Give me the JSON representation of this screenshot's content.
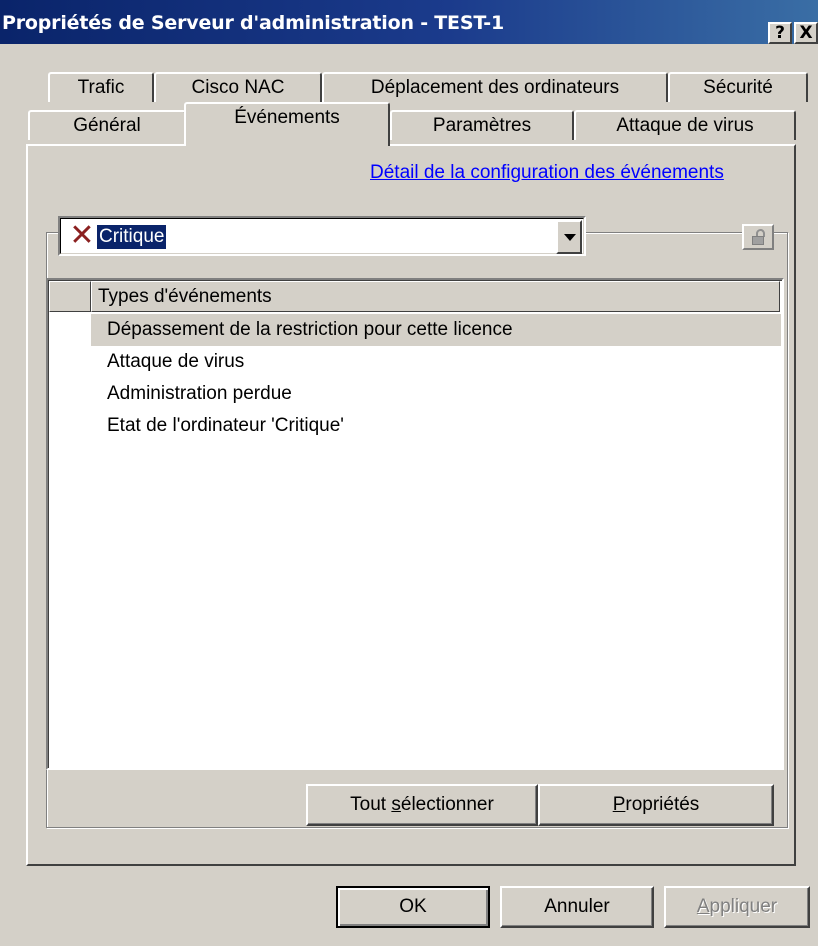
{
  "window": {
    "title": "Propriétés de Serveur d'administration - TEST-1",
    "help_button": "?",
    "close_button": "X"
  },
  "tabs_back_row": [
    {
      "label": "Trafic"
    },
    {
      "label": "Cisco NAC"
    },
    {
      "label": "Déplacement des ordinateurs"
    },
    {
      "label": "Sécurité"
    }
  ],
  "tabs_front_row": [
    {
      "label": "Général"
    },
    {
      "label": "Événements",
      "active": true
    },
    {
      "label": "Paramètres"
    },
    {
      "label": "Attaque de virus"
    }
  ],
  "events": {
    "config_link": "Détail de la configuration des événements",
    "severity_select": {
      "value": "Critique",
      "icon": "red-x-critical-icon"
    },
    "lock_icon": "padlock-icon",
    "list": {
      "column_header": "Types d'événements",
      "rows": [
        "Dépassement de la restriction pour cette licence",
        "Attaque de virus",
        "Administration perdue",
        "Etat de l'ordinateur 'Critique'"
      ],
      "selected_index": 0
    },
    "buttons": {
      "select_all_prefix": "Tout ",
      "select_all_accel": "s",
      "select_all_suffix": "électionner",
      "properties_accel": "P",
      "properties_suffix": "ropriétés"
    }
  },
  "dialog_buttons": {
    "ok": "OK",
    "cancel": "Annuler",
    "apply_accel": "A",
    "apply_suffix": "ppliquer",
    "apply_enabled": false
  },
  "colors": {
    "titlebar_start": "#0a246a",
    "titlebar_end": "#3a6ea5",
    "face": "#d4d0c8",
    "link": "#0000ff",
    "critical_icon": "#8b2020",
    "selection": "#0a246a"
  }
}
